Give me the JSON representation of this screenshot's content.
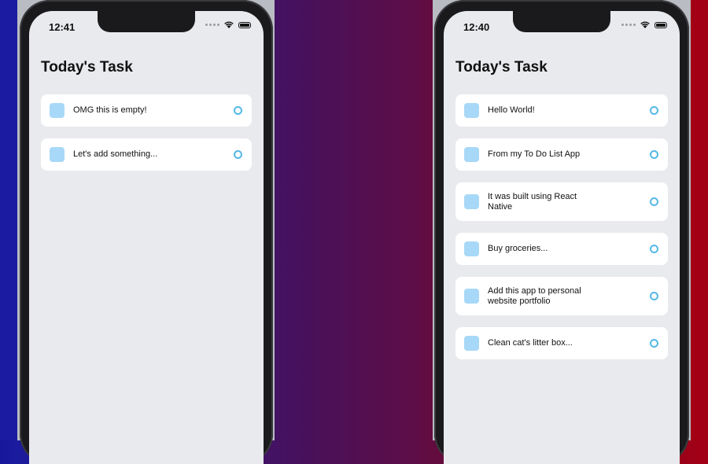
{
  "phones": [
    {
      "time": "12:41",
      "title": "Today's Task",
      "tasks": [
        "OMG this is empty!",
        "Let's add something..."
      ]
    },
    {
      "time": "12:40",
      "title": "Today's Task",
      "tasks": [
        "Hello World!",
        "From my To Do List App",
        "It was built using React Native",
        "Buy groceries...",
        "Add this app to personal website portfolio",
        "Clean cat's litter box..."
      ]
    }
  ],
  "colors": {
    "task_square": "#a8d8f7",
    "task_circle": "#55b8e8",
    "screen_bg": "#e8eaed"
  }
}
